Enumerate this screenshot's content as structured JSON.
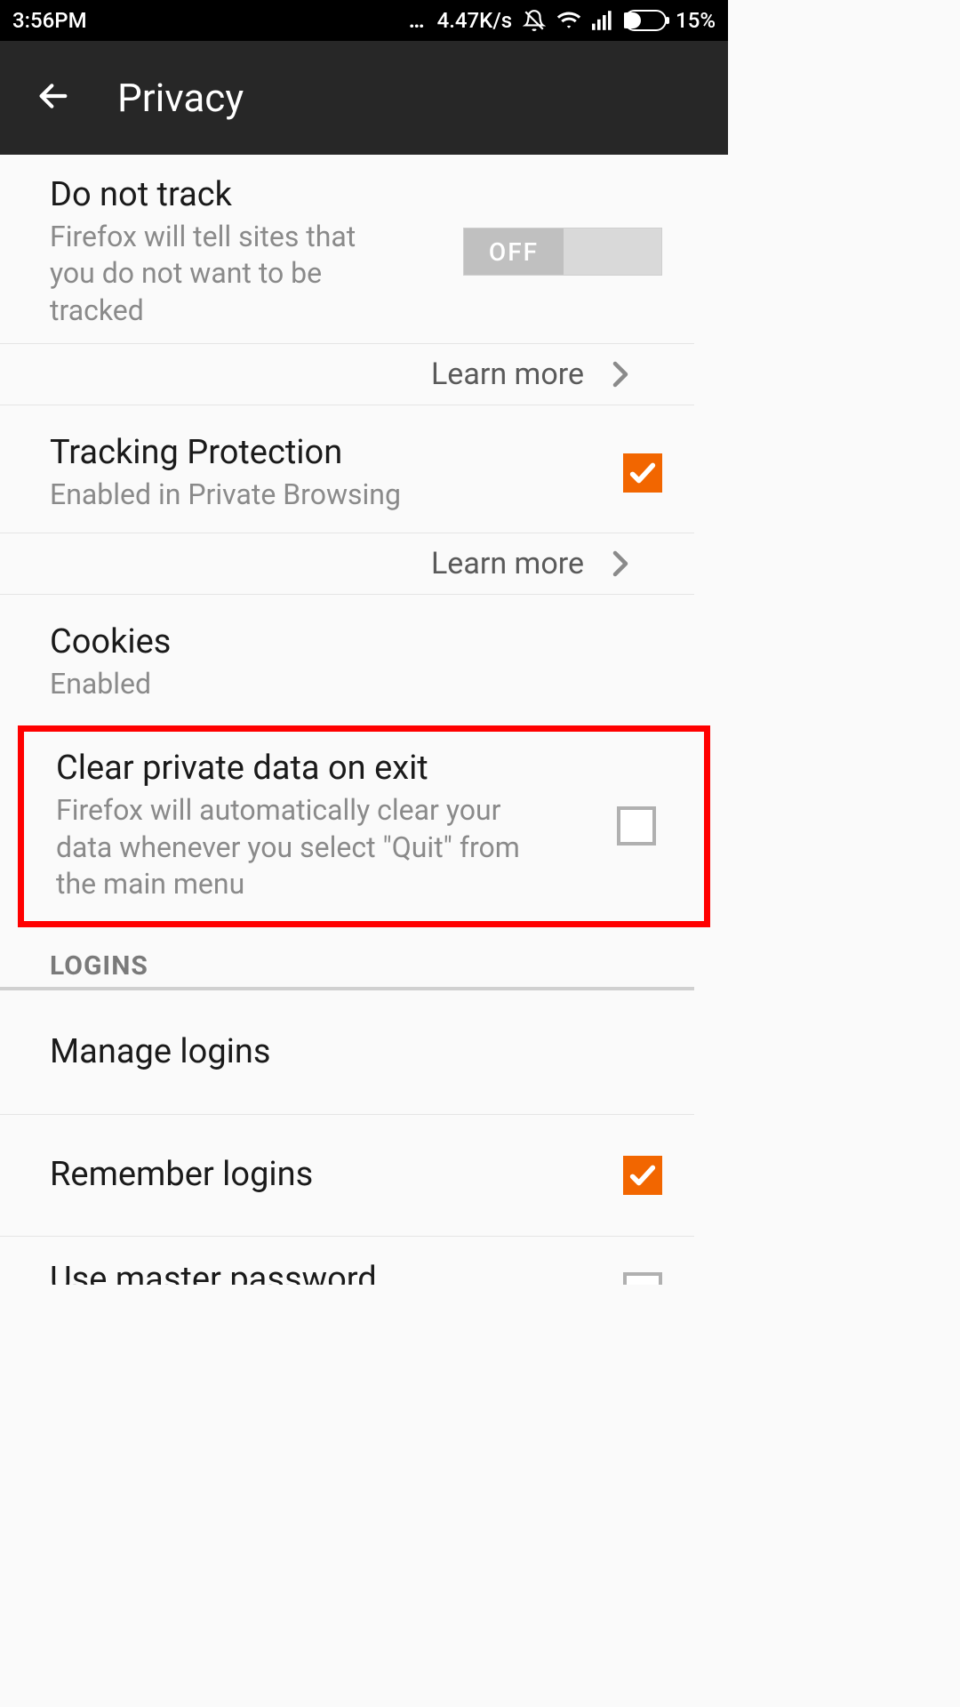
{
  "status": {
    "time": "3:56PM",
    "speed": "4.47K/s",
    "battery_percent": "15%"
  },
  "appbar": {
    "title": "Privacy"
  },
  "rows": {
    "dnt": {
      "title": "Do not track",
      "subtitle": "Firefox will tell sites that you do not want to be tracked",
      "toggle_off_label": "OFF"
    },
    "learn_more_1": "Learn more",
    "tracking": {
      "title": "Tracking Protection",
      "subtitle": "Enabled in Private Browsing"
    },
    "learn_more_2": "Learn more",
    "cookies": {
      "title": "Cookies",
      "subtitle": "Enabled"
    },
    "clear_on_exit": {
      "title": "Clear private data on exit",
      "subtitle": "Firefox will automatically clear your data whenever you select \"Quit\" from the main menu"
    },
    "section_logins": "LOGINS",
    "manage_logins": {
      "title": "Manage logins"
    },
    "remember_logins": {
      "title": "Remember logins"
    },
    "master_password": {
      "title": "Use master password"
    }
  }
}
